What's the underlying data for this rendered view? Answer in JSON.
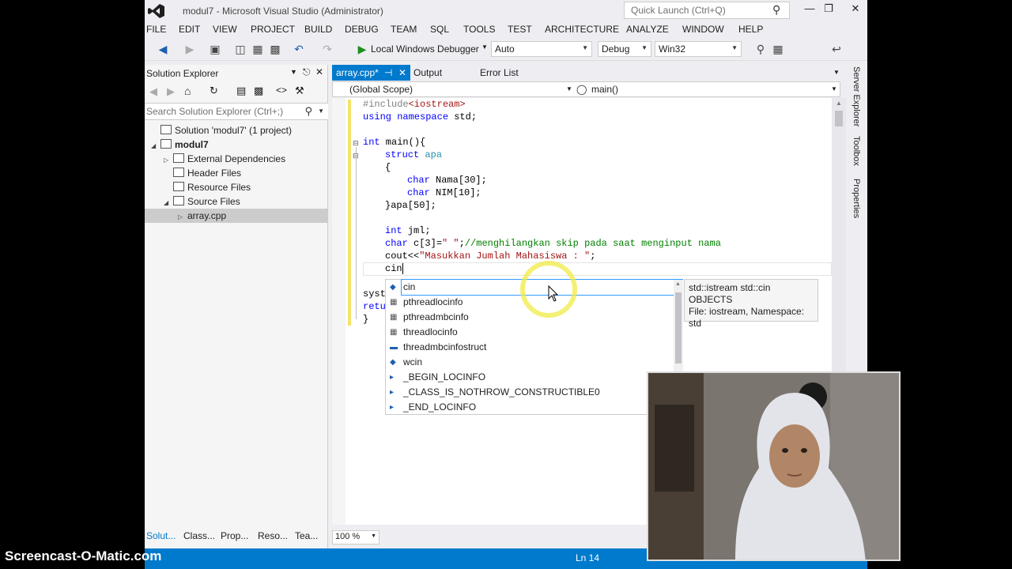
{
  "window": {
    "title": "modul7 - Microsoft Visual Studio (Administrator)",
    "quick_launch_placeholder": "Quick Launch (Ctrl+Q)",
    "minimize": "—",
    "maximize": "❐",
    "close": "✕"
  },
  "menu": [
    "FILE",
    "EDIT",
    "VIEW",
    "PROJECT",
    "BUILD",
    "DEBUG",
    "TEAM",
    "SQL",
    "TOOLS",
    "TEST",
    "ARCHITECTURE",
    "ANALYZE",
    "WINDOW",
    "HELP"
  ],
  "toolbar": {
    "debugger": "Local Windows Debugger",
    "auto": "Auto",
    "config": "Debug",
    "platform": "Win32"
  },
  "solution_explorer": {
    "title": "Solution Explorer",
    "search_placeholder": "Search Solution Explorer (Ctrl+;)",
    "tree": [
      {
        "label": "Solution 'modul7' (1 project)",
        "indent": 0,
        "twisty": ""
      },
      {
        "label": "modul7",
        "indent": 1,
        "twisty": "◢",
        "bold": true
      },
      {
        "label": "External Dependencies",
        "indent": 2,
        "twisty": "▷"
      },
      {
        "label": "Header Files",
        "indent": 2,
        "twisty": ""
      },
      {
        "label": "Resource Files",
        "indent": 2,
        "twisty": ""
      },
      {
        "label": "Source Files",
        "indent": 2,
        "twisty": "◢"
      },
      {
        "label": "array.cpp",
        "indent": 3,
        "twisty": "▷",
        "selected": true
      }
    ]
  },
  "editor_tabs": {
    "active": "array.cpp*",
    "pin": "⊣",
    "close": "✕",
    "output": "Output",
    "error_list": "Error List"
  },
  "nav": {
    "scope": "(Global Scope)",
    "member": "main()"
  },
  "code": {
    "l1_pp": "#include",
    "l1_inc": "<iostream>",
    "l2_kw": "using namespace",
    "l2_rest": " std;",
    "l4_kw": "int",
    "l4_rest": " main(){",
    "l5_kw": "struct",
    "l5_ty": "apa",
    "l6": "{",
    "l7_kw": "char",
    "l7_rest": " Nama[30];",
    "l8_kw": "char",
    "l8_rest": " NIM[10];",
    "l9": "}apa[50];",
    "l11_kw": "int",
    "l11_rest": " jml;",
    "l12_kw": "char",
    "l12_rest": " c[3]=",
    "l12_str": "\" \"",
    "l12_semi": ";",
    "l12_cmt": "//menghilangkan skip pada saat menginput nama",
    "l13_pre": "cout<<",
    "l13_str": "\"Masukkan Jumlah Mahasiswa : \"",
    "l13_semi": ";",
    "l14": "cin",
    "l16a": "syst",
    "l17a_kw": "retu",
    "l18": "}"
  },
  "intellisense": {
    "items": [
      {
        "label": "cin",
        "icon": "variable-icon",
        "selected": true
      },
      {
        "label": "pthreadlocinfo",
        "icon": "typedef-icon"
      },
      {
        "label": "pthreadmbcinfo",
        "icon": "typedef-icon"
      },
      {
        "label": "threadlocinfo",
        "icon": "typedef-icon"
      },
      {
        "label": "threadmbcinfostruct",
        "icon": "struct-icon"
      },
      {
        "label": "wcin",
        "icon": "variable-icon"
      },
      {
        "label": "_BEGIN_LOCINFO",
        "icon": "macro-icon"
      },
      {
        "label": "_CLASS_IS_NOTHROW_CONSTRUCTIBLE0",
        "icon": "macro-icon"
      },
      {
        "label": "_END_LOCINFO",
        "icon": "macro-icon"
      }
    ],
    "tooltip": {
      "line1": "std::istream std::cin",
      "line2": "OBJECTS",
      "line3": "File: iostream, Namespace: std"
    }
  },
  "right_strip": [
    "Server Explorer",
    "Toolbox",
    "Properties"
  ],
  "bottom_tabs": [
    "Solut...",
    "Class...",
    "Prop...",
    "Reso...",
    "Tea..."
  ],
  "zoom": "100 %",
  "status": {
    "line": "Ln 14"
  },
  "watermark": "Screencast-O-Matic.com",
  "colors": {
    "accent": "#007acc",
    "highlight_ring": "#f0eb46"
  }
}
